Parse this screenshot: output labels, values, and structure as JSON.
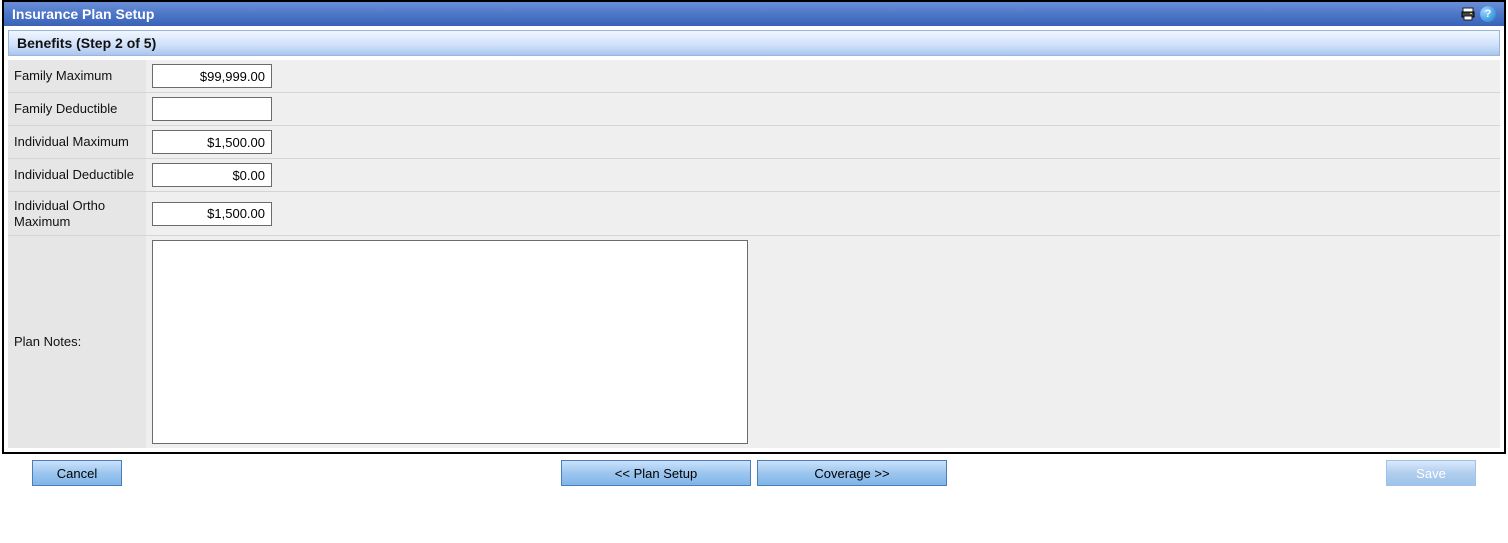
{
  "titlebar": {
    "title": "Insurance Plan Setup"
  },
  "subheader": {
    "text": "Benefits (Step 2 of 5)"
  },
  "fields": {
    "family_maximum": {
      "label": "Family Maximum",
      "value": "$99,999.00"
    },
    "family_deductible": {
      "label": "Family Deductible",
      "value": ""
    },
    "individual_maximum": {
      "label": "Individual Maximum",
      "value": "$1,500.00"
    },
    "individual_deductible": {
      "label": "Individual Deductible",
      "value": "$0.00"
    },
    "individual_ortho_max": {
      "label": "Individual Ortho Maximum",
      "value": "$1,500.00"
    },
    "plan_notes": {
      "label": "Plan Notes:",
      "value": ""
    }
  },
  "buttons": {
    "cancel": "Cancel",
    "prev": "<< Plan Setup",
    "next": "Coverage >>",
    "save": "Save"
  }
}
